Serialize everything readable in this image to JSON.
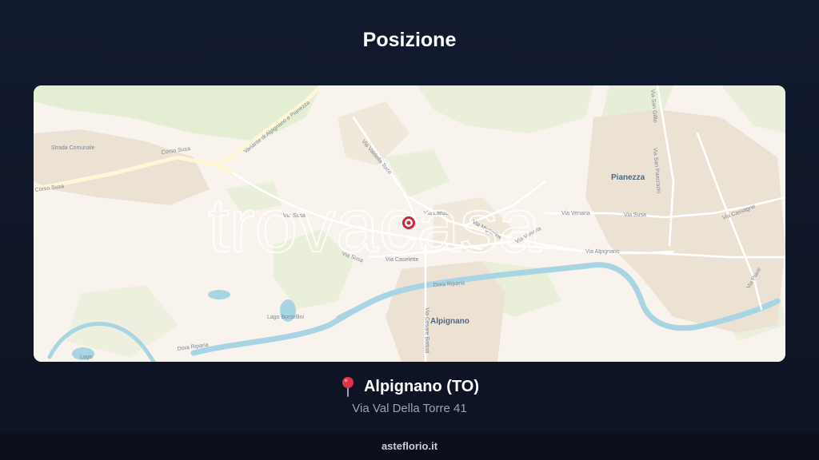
{
  "page": {
    "title": "Posizione"
  },
  "map": {
    "watermark": "trovacasa",
    "towns": [
      "Pianezza",
      "Alpignano"
    ],
    "streets": [
      "Via Susa",
      "Via Susa",
      "Corso Susa",
      "Corso Susa",
      "Strada Comunale",
      "Variante di Alpignano e Pianezza",
      "Via Caselette",
      "Via Venaria",
      "Via Susa",
      "Via Cassagne",
      "Via Alpignano",
      "Via Piave",
      "Via San Gillio",
      "Via San Pancrazio",
      "Via Valdella Torre",
      "Via Lanzo",
      "Via Venaria",
      "Via Migliarine",
      "Dora Riparia",
      "Dora Riparia",
      "Via Cesare Battisti",
      "Lago Borsellini",
      "Lago"
    ],
    "colors": {
      "water": "#a9d6e5",
      "park": "#d9e8c4",
      "urban": "#ede3d4",
      "pin": "#c9283e"
    }
  },
  "location": {
    "pin_icon": "map-pin-icon",
    "city": "Alpignano (TO)",
    "address": "Via Val Della Torre 41"
  },
  "footer": {
    "brand": "asteflorio.it"
  }
}
